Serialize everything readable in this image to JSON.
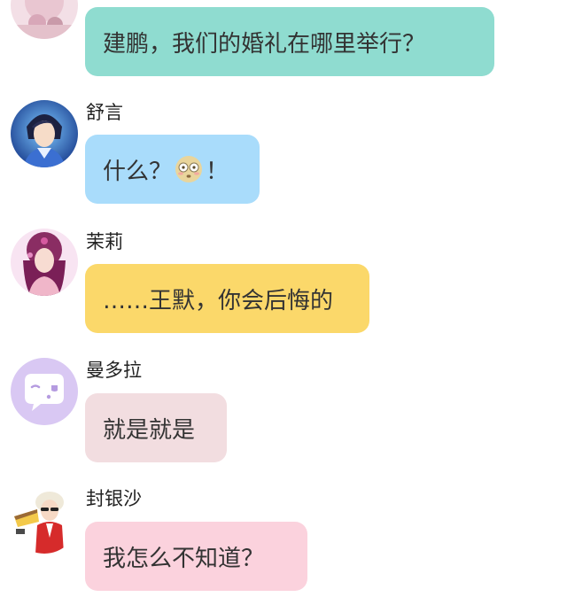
{
  "messages": [
    {
      "id": "m1",
      "name": "",
      "text": "建鹏，我们的婚礼在哪里举行？",
      "bubble_color": "#8fdcd0",
      "avatar": "female-avatar"
    },
    {
      "id": "m2",
      "name": "舒言",
      "text_before": "什么？",
      "text_after": "！",
      "emoji": "flushed-face-icon",
      "bubble_color": "#a9dcfb",
      "avatar": "male-character-avatar"
    },
    {
      "id": "m3",
      "name": "茉莉",
      "text": "……王默，你会后悔的",
      "bubble_color": "#fbd86a",
      "avatar": "female-character-avatar"
    },
    {
      "id": "m4",
      "name": "曼多拉",
      "text": "就是就是",
      "bubble_color": "#f2dde0",
      "avatar": "chat-bubble-icon-avatar"
    },
    {
      "id": "m5",
      "name": "封银沙",
      "text": "我怎么不知道？",
      "bubble_color": "#fbd2dd",
      "avatar": "boy-character-avatar"
    }
  ]
}
